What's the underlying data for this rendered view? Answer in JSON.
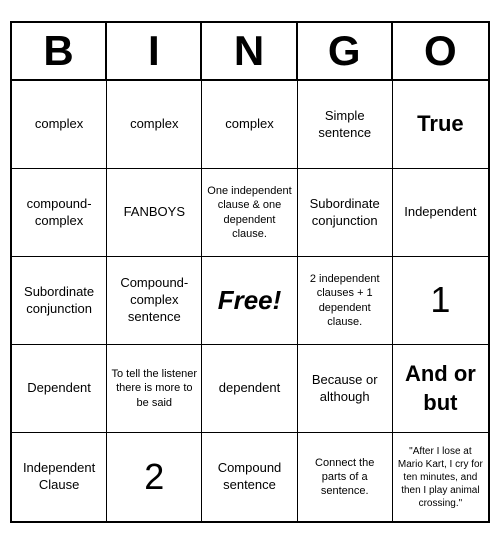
{
  "header": {
    "letters": [
      "B",
      "I",
      "N",
      "G",
      "O"
    ]
  },
  "cells": [
    {
      "text": "complex",
      "style": "normal"
    },
    {
      "text": "complex",
      "style": "normal"
    },
    {
      "text": "complex",
      "style": "normal"
    },
    {
      "text": "Simple sentence",
      "style": "normal"
    },
    {
      "text": "True",
      "style": "large"
    },
    {
      "text": "compound-complex",
      "style": "normal"
    },
    {
      "text": "FANBOYS",
      "style": "normal"
    },
    {
      "text": "One independent clause & one dependent clause.",
      "style": "small"
    },
    {
      "text": "Subordinate conjunction",
      "style": "normal"
    },
    {
      "text": "Independent",
      "style": "normal"
    },
    {
      "text": "Subordinate conjunction",
      "style": "normal"
    },
    {
      "text": "Compound-complex sentence",
      "style": "normal"
    },
    {
      "text": "Free!",
      "style": "free"
    },
    {
      "text": "2 independent clauses + 1 dependent clause.",
      "style": "small"
    },
    {
      "text": "1",
      "style": "number"
    },
    {
      "text": "Dependent",
      "style": "normal"
    },
    {
      "text": "To tell the listener there is more to be said",
      "style": "small"
    },
    {
      "text": "dependent",
      "style": "normal"
    },
    {
      "text": "Because or although",
      "style": "normal"
    },
    {
      "text": "And or but",
      "style": "large"
    },
    {
      "text": "Independent Clause",
      "style": "normal"
    },
    {
      "text": "2",
      "style": "number"
    },
    {
      "text": "Compound sentence",
      "style": "normal"
    },
    {
      "text": "Connect the parts of a sentence.",
      "style": "small"
    },
    {
      "text": "\"After I lose at Mario Kart, I cry for ten minutes, and then I play animal crossing.\"",
      "style": "tiny"
    }
  ]
}
